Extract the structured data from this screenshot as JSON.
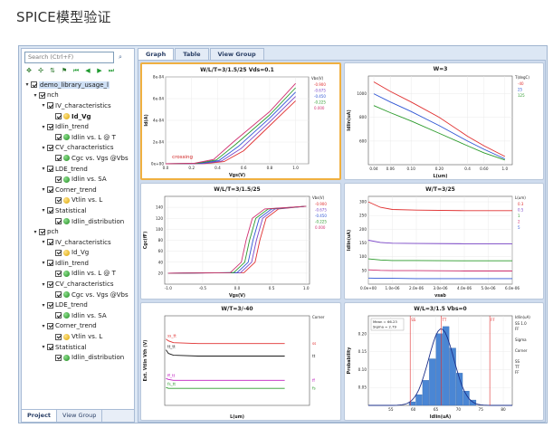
{
  "page_title": "SPICE模型验证",
  "left_panel": {
    "search_placeholder": "Search (Ctrl+F)",
    "bottom_tabs": [
      "Project",
      "View Group"
    ],
    "tree": [
      {
        "label": "demo_library_usage_l",
        "level": 0,
        "twisty": "v",
        "kind": "folder",
        "sel": true
      },
      {
        "label": "nch",
        "level": 1,
        "twisty": "v",
        "kind": "folder"
      },
      {
        "label": "IV_characteristics",
        "level": 2,
        "twisty": "v",
        "kind": "folder"
      },
      {
        "label": "Id_Vg",
        "level": 3,
        "kind": "leaf",
        "icon": "y",
        "bold": true
      },
      {
        "label": "Idlin_trend",
        "level": 2,
        "twisty": "v",
        "kind": "folder"
      },
      {
        "label": "Idlin vs. L @ T",
        "level": 3,
        "kind": "leaf",
        "icon": "g"
      },
      {
        "label": "CV_characteristics",
        "level": 2,
        "twisty": "v",
        "kind": "folder"
      },
      {
        "label": "Cgc vs. Vgs @Vbs",
        "level": 3,
        "kind": "leaf",
        "icon": "g"
      },
      {
        "label": "LDE_trend",
        "level": 2,
        "twisty": "v",
        "kind": "folder"
      },
      {
        "label": "Idlin vs. SA",
        "level": 3,
        "kind": "leaf",
        "icon": "g"
      },
      {
        "label": "Corner_trend",
        "level": 2,
        "twisty": "v",
        "kind": "folder"
      },
      {
        "label": "Vtlin vs. L",
        "level": 3,
        "kind": "leaf",
        "icon": "y"
      },
      {
        "label": "Statistical",
        "level": 2,
        "twisty": "v",
        "kind": "folder"
      },
      {
        "label": "Idlin_distribution",
        "level": 3,
        "kind": "leaf",
        "icon": "g"
      },
      {
        "label": "pch",
        "level": 1,
        "twisty": "v",
        "kind": "folder"
      },
      {
        "label": "IV_characteristics",
        "level": 2,
        "twisty": "v",
        "kind": "folder"
      },
      {
        "label": "Id_Vg",
        "level": 3,
        "kind": "leaf",
        "icon": "y"
      },
      {
        "label": "Idlin_trend",
        "level": 2,
        "twisty": "v",
        "kind": "folder"
      },
      {
        "label": "Idlin vs. L @ T",
        "level": 3,
        "kind": "leaf",
        "icon": "g"
      },
      {
        "label": "CV_characteristics",
        "level": 2,
        "twisty": "v",
        "kind": "folder"
      },
      {
        "label": "Cgc vs. Vgs @Vbs",
        "level": 3,
        "kind": "leaf",
        "icon": "g"
      },
      {
        "label": "LDE_trend",
        "level": 2,
        "twisty": "v",
        "kind": "folder"
      },
      {
        "label": "Idlin vs. SA",
        "level": 3,
        "kind": "leaf",
        "icon": "g"
      },
      {
        "label": "Corner_trend",
        "level": 2,
        "twisty": "v",
        "kind": "folder"
      },
      {
        "label": "Vtlin vs. L",
        "level": 3,
        "kind": "leaf",
        "icon": "y"
      },
      {
        "label": "Statistical",
        "level": 2,
        "twisty": "v",
        "kind": "folder"
      },
      {
        "label": "Idlin_distribution",
        "level": 3,
        "kind": "leaf",
        "icon": "g"
      }
    ]
  },
  "graph_tabs": [
    "Graph",
    "Table",
    "View Group"
  ],
  "chart_data": [
    {
      "id": "idvg",
      "type": "line",
      "title": "W/L/T=3/1.5/25 Vds=0.1",
      "xlabel": "Vgs(V)",
      "ylabel": "Id(A)",
      "xlim": [
        0,
        1.1
      ],
      "ylim": [
        0,
        0.0008
      ],
      "x_ticks": [
        0,
        0.2,
        0.4,
        0.6,
        0.8,
        1.0
      ],
      "x_tick_labels": [
        "0.0",
        "0.2",
        "0.4",
        "0.6",
        "0.8",
        "1.0"
      ],
      "y_ticks": [
        0,
        0.0002,
        0.0004,
        0.0006,
        0.0008
      ],
      "y_tick_labels": [
        "0e+00",
        "2e-04",
        "4e-04",
        "6e-04",
        "8e-04"
      ],
      "legend_title": "Vbs(V)",
      "legend_position": "right",
      "annotation": "crossing",
      "series": [
        {
          "name": "-0.900",
          "color": "#e03030",
          "x": [
            0,
            0.3,
            0.45,
            0.6,
            0.8,
            1.0
          ],
          "y": [
            0,
            2e-06,
            2e-05,
            0.00012,
            0.00035,
            0.00058
          ]
        },
        {
          "name": "-0.675",
          "color": "#7a45c8",
          "x": [
            0,
            0.28,
            0.43,
            0.58,
            0.8,
            1.0
          ],
          "y": [
            0,
            2e-06,
            2.5e-05,
            0.00014,
            0.000385,
            0.00062
          ]
        },
        {
          "name": "-0.450",
          "color": "#2f55d4",
          "x": [
            0,
            0.26,
            0.41,
            0.56,
            0.8,
            1.0
          ],
          "y": [
            0,
            3e-06,
            3e-05,
            0.00016,
            0.00042,
            0.00066
          ]
        },
        {
          "name": "-0.225",
          "color": "#2a9a2a",
          "x": [
            0,
            0.24,
            0.39,
            0.54,
            0.8,
            1.0
          ],
          "y": [
            0,
            3e-06,
            3.5e-05,
            0.00018,
            0.00045,
            0.0007
          ]
        },
        {
          "name": "0.000",
          "color": "#d03070",
          "x": [
            0,
            0.22,
            0.37,
            0.52,
            0.8,
            1.0
          ],
          "y": [
            0,
            4e-06,
            4e-05,
            0.0002,
            0.00048,
            0.00074
          ]
        }
      ]
    },
    {
      "id": "idlinL",
      "type": "line",
      "title": "W=3",
      "xlabel": "L(um)",
      "ylabel": "Idlin(uA)",
      "xlim": [
        0.035,
        1.2
      ],
      "ylim": [
        400,
        1150
      ],
      "x_ticks": [
        0.04,
        0.06,
        0.1,
        0.2,
        0.4,
        0.6,
        1.0
      ],
      "x_tick_labels": [
        "0.04",
        "0.06",
        "0.10",
        "0.20",
        "0.4",
        "0.60",
        "1.0"
      ],
      "y_ticks": [
        600,
        800,
        1000
      ],
      "y_tick_labels": [
        "600",
        "800",
        "1000"
      ],
      "log_x": true,
      "legend_title": "T(degC)",
      "legend_position": "right",
      "series": [
        {
          "name": "-40",
          "color": "#e03030",
          "x": [
            0.04,
            0.06,
            0.1,
            0.2,
            0.4,
            0.6,
            1.0
          ],
          "y": [
            1100,
            1020,
            930,
            800,
            640,
            560,
            470
          ]
        },
        {
          "name": "25",
          "color": "#2f55d4",
          "x": [
            0.04,
            0.06,
            0.1,
            0.2,
            0.4,
            0.6,
            1.0
          ],
          "y": [
            1000,
            930,
            850,
            730,
            600,
            530,
            450
          ]
        },
        {
          "name": "125",
          "color": "#2a9a2a",
          "x": [
            0.04,
            0.06,
            0.1,
            0.2,
            0.4,
            0.6,
            1.0
          ],
          "y": [
            900,
            840,
            770,
            665,
            560,
            500,
            440
          ]
        }
      ]
    },
    {
      "id": "cgc",
      "type": "line",
      "title": "W/L/T=3/1.5/25",
      "xlabel": "Vgs(V)",
      "ylabel": "Cgc(fF)",
      "xlim": [
        -1.05,
        1.05
      ],
      "ylim": [
        0,
        160
      ],
      "x_ticks": [
        -1,
        -0.5,
        0,
        0.5,
        1
      ],
      "x_tick_labels": [
        "-1.0",
        "-0.5",
        "0.0",
        "0.5",
        "1.0"
      ],
      "y_ticks": [
        20,
        40,
        60,
        80,
        100,
        120,
        140
      ],
      "y_tick_labels": [
        "20",
        "40",
        "60",
        "80",
        "100",
        "120",
        "140"
      ],
      "legend_title": "Vbs(V)",
      "legend_position": "right",
      "series": [
        {
          "name": "-0.900",
          "color": "#e03030",
          "x": [
            -1,
            0.1,
            0.26,
            0.33,
            0.42,
            0.6,
            1.0
          ],
          "y": [
            20,
            21,
            40,
            80,
            120,
            137,
            142
          ]
        },
        {
          "name": "-0.675",
          "color": "#7a45c8",
          "x": [
            -1,
            0.05,
            0.21,
            0.28,
            0.37,
            0.55,
            1.0
          ],
          "y": [
            20,
            21,
            40,
            80,
            120,
            137,
            142
          ]
        },
        {
          "name": "-0.450",
          "color": "#2f55d4",
          "x": [
            -1,
            0.0,
            0.16,
            0.23,
            0.32,
            0.5,
            1.0
          ],
          "y": [
            20,
            21,
            40,
            80,
            120,
            137,
            142
          ]
        },
        {
          "name": "-0.225",
          "color": "#2a9a2a",
          "x": [
            -1,
            -0.05,
            0.11,
            0.18,
            0.27,
            0.45,
            1.0
          ],
          "y": [
            20,
            21,
            40,
            80,
            120,
            137,
            142
          ]
        },
        {
          "name": "0.000",
          "color": "#d03070",
          "x": [
            -1,
            -0.1,
            0.06,
            0.13,
            0.22,
            0.4,
            1.0
          ],
          "y": [
            20,
            21,
            40,
            80,
            120,
            137,
            142
          ]
        }
      ]
    },
    {
      "id": "idlinSA",
      "type": "line",
      "title": "W/T=3/25",
      "xlabel": "vsab",
      "ylabel": "Idlin(uA)",
      "xlim": [
        0,
        6e-06
      ],
      "ylim": [
        0,
        320
      ],
      "x_ticks": [
        0,
        1e-06,
        2e-06,
        3e-06,
        4e-06,
        5e-06,
        6e-06
      ],
      "x_tick_labels": [
        "0.0e+00",
        "1.0e-06",
        "2.0e-06",
        "3.0e-06",
        "4.0e-06",
        "5.0e-06",
        "6.0e-06"
      ],
      "y_ticks": [
        50,
        100,
        150,
        200,
        250,
        300
      ],
      "y_tick_labels": [
        "50",
        "100",
        "150",
        "200",
        "250",
        "300"
      ],
      "legend_title": "L(um)",
      "legend_position": "right",
      "series": [
        {
          "name": "0.3",
          "color": "#e03030",
          "x": [
            0,
            5e-07,
            1e-06,
            2e-06,
            4e-06,
            6e-06
          ],
          "y": [
            300,
            280,
            272,
            270,
            268,
            268
          ]
        },
        {
          "name": "0.5",
          "color": "#7a45c8",
          "x": [
            0,
            5e-07,
            1e-06,
            2e-06,
            4e-06,
            6e-06
          ],
          "y": [
            160,
            152,
            149,
            148,
            147,
            147
          ]
        },
        {
          "name": "1",
          "color": "#2a9a2a",
          "x": [
            0,
            5e-07,
            1e-06,
            2e-06,
            4e-06,
            6e-06
          ],
          "y": [
            92,
            88,
            86,
            86,
            85,
            85
          ]
        },
        {
          "name": "2",
          "color": "#d03070",
          "x": [
            0,
            5e-07,
            1e-06,
            2e-06,
            4e-06,
            6e-06
          ],
          "y": [
            52,
            50,
            49,
            49,
            48,
            48
          ]
        },
        {
          "name": "5",
          "color": "#2f55d4",
          "x": [
            0,
            5e-07,
            1e-06,
            2e-06,
            4e-06,
            6e-06
          ],
          "y": [
            22,
            21,
            21,
            20,
            20,
            20
          ]
        }
      ]
    },
    {
      "id": "corner",
      "type": "line",
      "title": "W/T=3/-40",
      "xlabel": "L(um)",
      "ylabel": "Ext. Vtlin Vth (V)",
      "xlim": [
        0.03,
        1.2
      ],
      "ylim": [
        0.0,
        1.0
      ],
      "legend_title": "Corner",
      "legend_position": "right",
      "labels_on_curves": true,
      "series": [
        {
          "name": "ss",
          "label": "ss_tt",
          "color": "#e03030",
          "x": [
            0.04,
            0.06,
            0.1,
            0.3,
            1.0
          ],
          "y": [
            0.74,
            0.72,
            0.7,
            0.69,
            0.69
          ]
        },
        {
          "name": "tt",
          "label": "tt_tt",
          "color": "#1a1a1a",
          "x": [
            0.04,
            0.06,
            0.1,
            0.3,
            1.0
          ],
          "y": [
            0.62,
            0.58,
            0.56,
            0.55,
            0.55
          ]
        },
        {
          "name": "ff",
          "label": "ff_tt",
          "color": "#c020c0",
          "x": [
            0.04,
            0.06,
            0.1,
            0.3,
            1.0
          ],
          "y": [
            0.3,
            0.29,
            0.28,
            0.28,
            0.28
          ]
        },
        {
          "name": "fs",
          "label": "fs_tt",
          "color": "#2a9a2a",
          "x": [
            0.04,
            0.06,
            0.1,
            0.3,
            1.0
          ],
          "y": [
            0.2,
            0.19,
            0.19,
            0.19,
            0.19
          ]
        }
      ]
    },
    {
      "id": "hist",
      "type": "bar",
      "title": "W/L=3/1.5 Vbs=0",
      "xlabel": "Idlin(uA)",
      "ylabel": "Probability",
      "xlim": [
        50,
        82
      ],
      "ylim": [
        0,
        0.25
      ],
      "x_ticks": [
        55,
        60,
        65,
        70,
        75,
        80
      ],
      "x_tick_labels": [
        "55",
        "60",
        "65",
        "70",
        "75",
        "80"
      ],
      "y_ticks": [
        0.05,
        0.1,
        0.15,
        0.2
      ],
      "y_tick_labels": [
        "0.05",
        "0.10",
        "0.15",
        "0.20"
      ],
      "bins": [
        59,
        60.5,
        62,
        63.5,
        65,
        66.5,
        68,
        69.5,
        71,
        72.5,
        74
      ],
      "values": [
        0.01,
        0.03,
        0.07,
        0.13,
        0.2,
        0.22,
        0.16,
        0.09,
        0.04,
        0.015
      ],
      "fit_mean": 66.2,
      "fit_sigma": 2.8,
      "stats": [
        "Mean = 66.23",
        "Sigma = 2.79"
      ],
      "legend_title": "Idlin(uA)",
      "legend_lines": [
        "SS 1.0",
        "FF",
        "",
        "Sigma",
        "",
        "Corner",
        "",
        "SS",
        "TT",
        "FF"
      ],
      "corner_lines": [
        {
          "name": "SS",
          "x": 59.3,
          "color": "#e03030"
        },
        {
          "name": "TT",
          "x": 66.2,
          "color": "#e03030"
        },
        {
          "name": "FF",
          "x": 77.0,
          "color": "#e03030"
        }
      ]
    }
  ]
}
